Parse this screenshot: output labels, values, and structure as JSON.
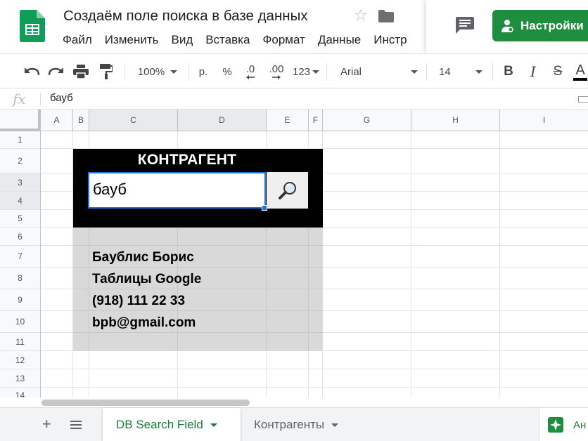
{
  "document": {
    "title": "Создаём поле поиска в базе данных"
  },
  "menu": [
    "Файл",
    "Изменить",
    "Вид",
    "Вставка",
    "Формат",
    "Данные",
    "Инстр"
  ],
  "header_buttons": {
    "settings_label": "Настройки"
  },
  "toolbar": {
    "zoom": "100%",
    "currency": "р.",
    "percent": "%",
    "decrease_decimals": ".0",
    "increase_decimals": ".00",
    "more_formats": "123",
    "font": "Arial",
    "font_size": "14",
    "bold": "B",
    "italic": "I",
    "strikethrough": "S",
    "text_color": "A"
  },
  "formula_bar": {
    "fx": "fx",
    "value": "бауб"
  },
  "columns": [
    "A",
    "B",
    "C",
    "D",
    "E",
    "F",
    "G",
    "H",
    "I"
  ],
  "rows": [
    "1",
    "2",
    "3",
    "4",
    "5",
    "6",
    "7",
    "8",
    "9",
    "10",
    "11",
    "12",
    "13",
    "14"
  ],
  "sheet_content": {
    "heading": "КОНТРАГЕНТ",
    "search_value": "бауб",
    "results": [
      "Баублис Борис",
      "Таблицы Google",
      "(918) 111 22 33",
      "bpb@gmail.com"
    ]
  },
  "sheets": {
    "tabs": [
      "DB Search Field",
      "Контрагенты"
    ],
    "active": "DB Search Field",
    "explore_label": "Ан"
  },
  "colors": {
    "accent_green": "#1e8e3e",
    "selection_blue": "#1a73e8",
    "block_black": "#000000",
    "result_gray": "#d9d9d9"
  }
}
